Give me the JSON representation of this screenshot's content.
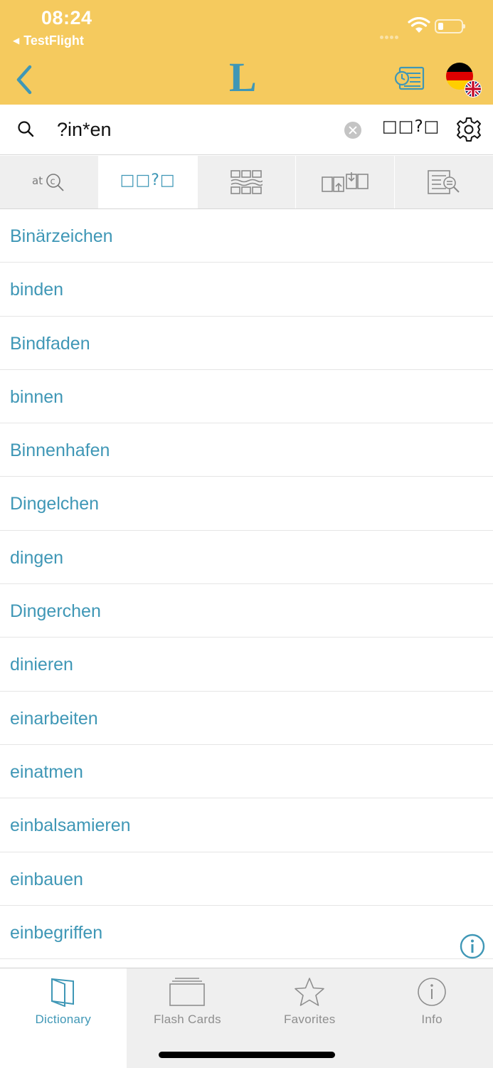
{
  "status_bar": {
    "time": "08:24",
    "back_app": "TestFlight"
  },
  "header": {
    "logo": "L",
    "accent_color": "#3f97b6",
    "header_color": "#f5ca5e"
  },
  "search": {
    "query": "?in*en",
    "mode_label": "□□?□"
  },
  "search_tabs": [
    {
      "name": "spelling-search",
      "label": "",
      "icon": "abc-search-icon"
    },
    {
      "name": "wildcard-search",
      "label": "□□?□",
      "icon": "wildcard-icon"
    },
    {
      "name": "crossword-search",
      "label": "",
      "icon": "grid-icon"
    },
    {
      "name": "anagram-search",
      "label": "",
      "icon": "swap-icon"
    },
    {
      "name": "fulltext-search",
      "label": "",
      "icon": "document-search-icon"
    }
  ],
  "results": [
    "Binärzeichen",
    "binden",
    "Bindfaden",
    "binnen",
    "Binnenhafen",
    "Dingelchen",
    "dingen",
    "Dingerchen",
    "dinieren",
    "einarbeiten",
    "einatmen",
    "einbalsamieren",
    "einbauen",
    "einbegriffen"
  ],
  "tabbar": {
    "dictionary": "Dictionary",
    "flash_cards": "Flash Cards",
    "favorites": "Favorites",
    "info": "Info"
  }
}
